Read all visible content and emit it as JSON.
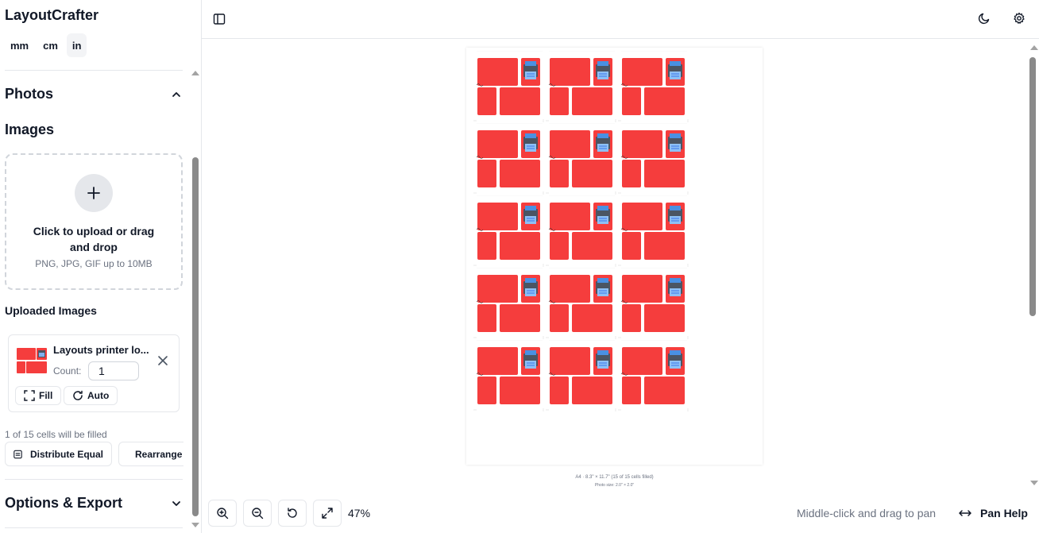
{
  "app": {
    "title": "LayoutCrafter"
  },
  "units": [
    {
      "label": "mm",
      "active": false
    },
    {
      "label": "cm",
      "active": false
    },
    {
      "label": "in",
      "active": true
    }
  ],
  "photos_section": {
    "label": "Photos",
    "expanded": true,
    "images_title": "Images",
    "dropzone": {
      "main_text": "Click to upload or drag and drop",
      "sub_text": "PNG, JPG, GIF up to 10MB"
    },
    "uploaded_title": "Uploaded Images",
    "uploaded": [
      {
        "name": "Layouts printer lo...",
        "count_label": "Count:",
        "count_value": "1",
        "fill_label": "Fill",
        "auto_label": "Auto"
      }
    ],
    "cells_note": "1 of 15 cells will be filled",
    "distribute_label": "Distribute Equal",
    "rearrange_label": "Rearrange"
  },
  "options_section": {
    "label": "Options & Export",
    "expanded": false
  },
  "canvas": {
    "grid_rows": 5,
    "grid_cols": 3,
    "caption_line1": "A4 · 8.3\" × 11.7\" (15 of 15 cells filled)",
    "caption_line2": "Photo size: 2.0\" × 2.0\""
  },
  "bottom": {
    "zoom": "47%",
    "pan_hint": "Middle-click and drag to pan",
    "pan_help": "Pan Help"
  },
  "colors": {
    "tile_red": "#f53d3d",
    "printer_blue": "#4a90e2",
    "border": "#e5e7eb"
  }
}
